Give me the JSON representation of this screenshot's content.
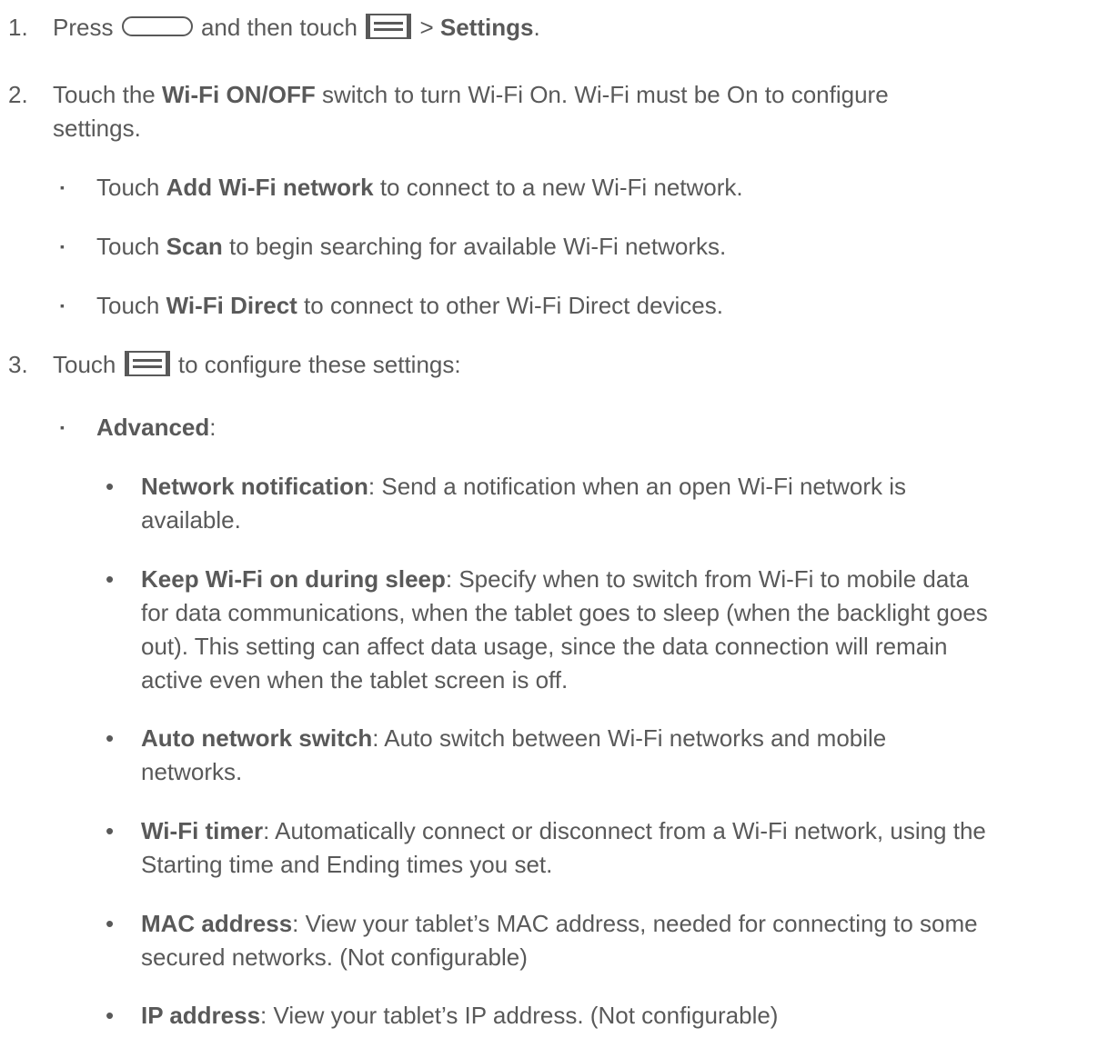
{
  "steps": [
    {
      "num": "1.",
      "parts": [
        "Press",
        "and then touch",
        ">",
        "Settings",
        "."
      ]
    },
    {
      "num": "2.",
      "line1_pre": "Touch the ",
      "line1_bold": "Wi-Fi ON/OFF",
      "line1_post": " switch to turn Wi-Fi On. Wi-Fi must be On to configure",
      "line2": "settings.",
      "bullets": [
        {
          "pre": "Touch ",
          "bold": "Add Wi-Fi network",
          "post": " to connect to a new Wi-Fi network."
        },
        {
          "pre": "Touch ",
          "bold": "Scan",
          "post": " to begin searching for available Wi-Fi networks."
        },
        {
          "pre": "Touch ",
          "bold": "Wi-Fi Direct",
          "post": " to connect to other Wi-Fi Direct devices."
        }
      ]
    },
    {
      "num": "3.",
      "pre": "Touch",
      "post": "to configure these settings:",
      "advanced_bold": "Advanced",
      "advanced_post": ":",
      "options": [
        {
          "bold": "Network notification",
          "lines": [
            ": Send a notification when an open Wi-Fi network is",
            "available."
          ]
        },
        {
          "bold": "Keep Wi-Fi on during sleep",
          "lines": [
            ": Specify when to switch from Wi-Fi to mobile data",
            "for data communications, when the tablet goes to sleep (when the backlight goes",
            "out). This setting can affect data usage, since the data connection will remain",
            "active even when the tablet screen is off."
          ]
        },
        {
          "bold": "Auto network switch",
          "lines": [
            ": Auto switch between Wi-Fi networks and mobile",
            "networks."
          ]
        },
        {
          "bold": "Wi-Fi timer",
          "lines": [
            ": Automatically connect or disconnect from a Wi-Fi network, using the",
            "Starting time and Ending times you set."
          ]
        },
        {
          "bold": "MAC address",
          "lines": [
            ": View your tablet’s MAC address, needed for connecting to some",
            "secured networks. (Not configurable)"
          ]
        },
        {
          "bold": "IP address",
          "lines": [
            ": View your tablet’s IP address. (Not configurable)"
          ]
        }
      ]
    }
  ],
  "bullet_square": "▪",
  "bullet_dot": "•",
  "icons": {
    "home_key": "home-key-icon",
    "menu_key": "menu-key-icon"
  }
}
